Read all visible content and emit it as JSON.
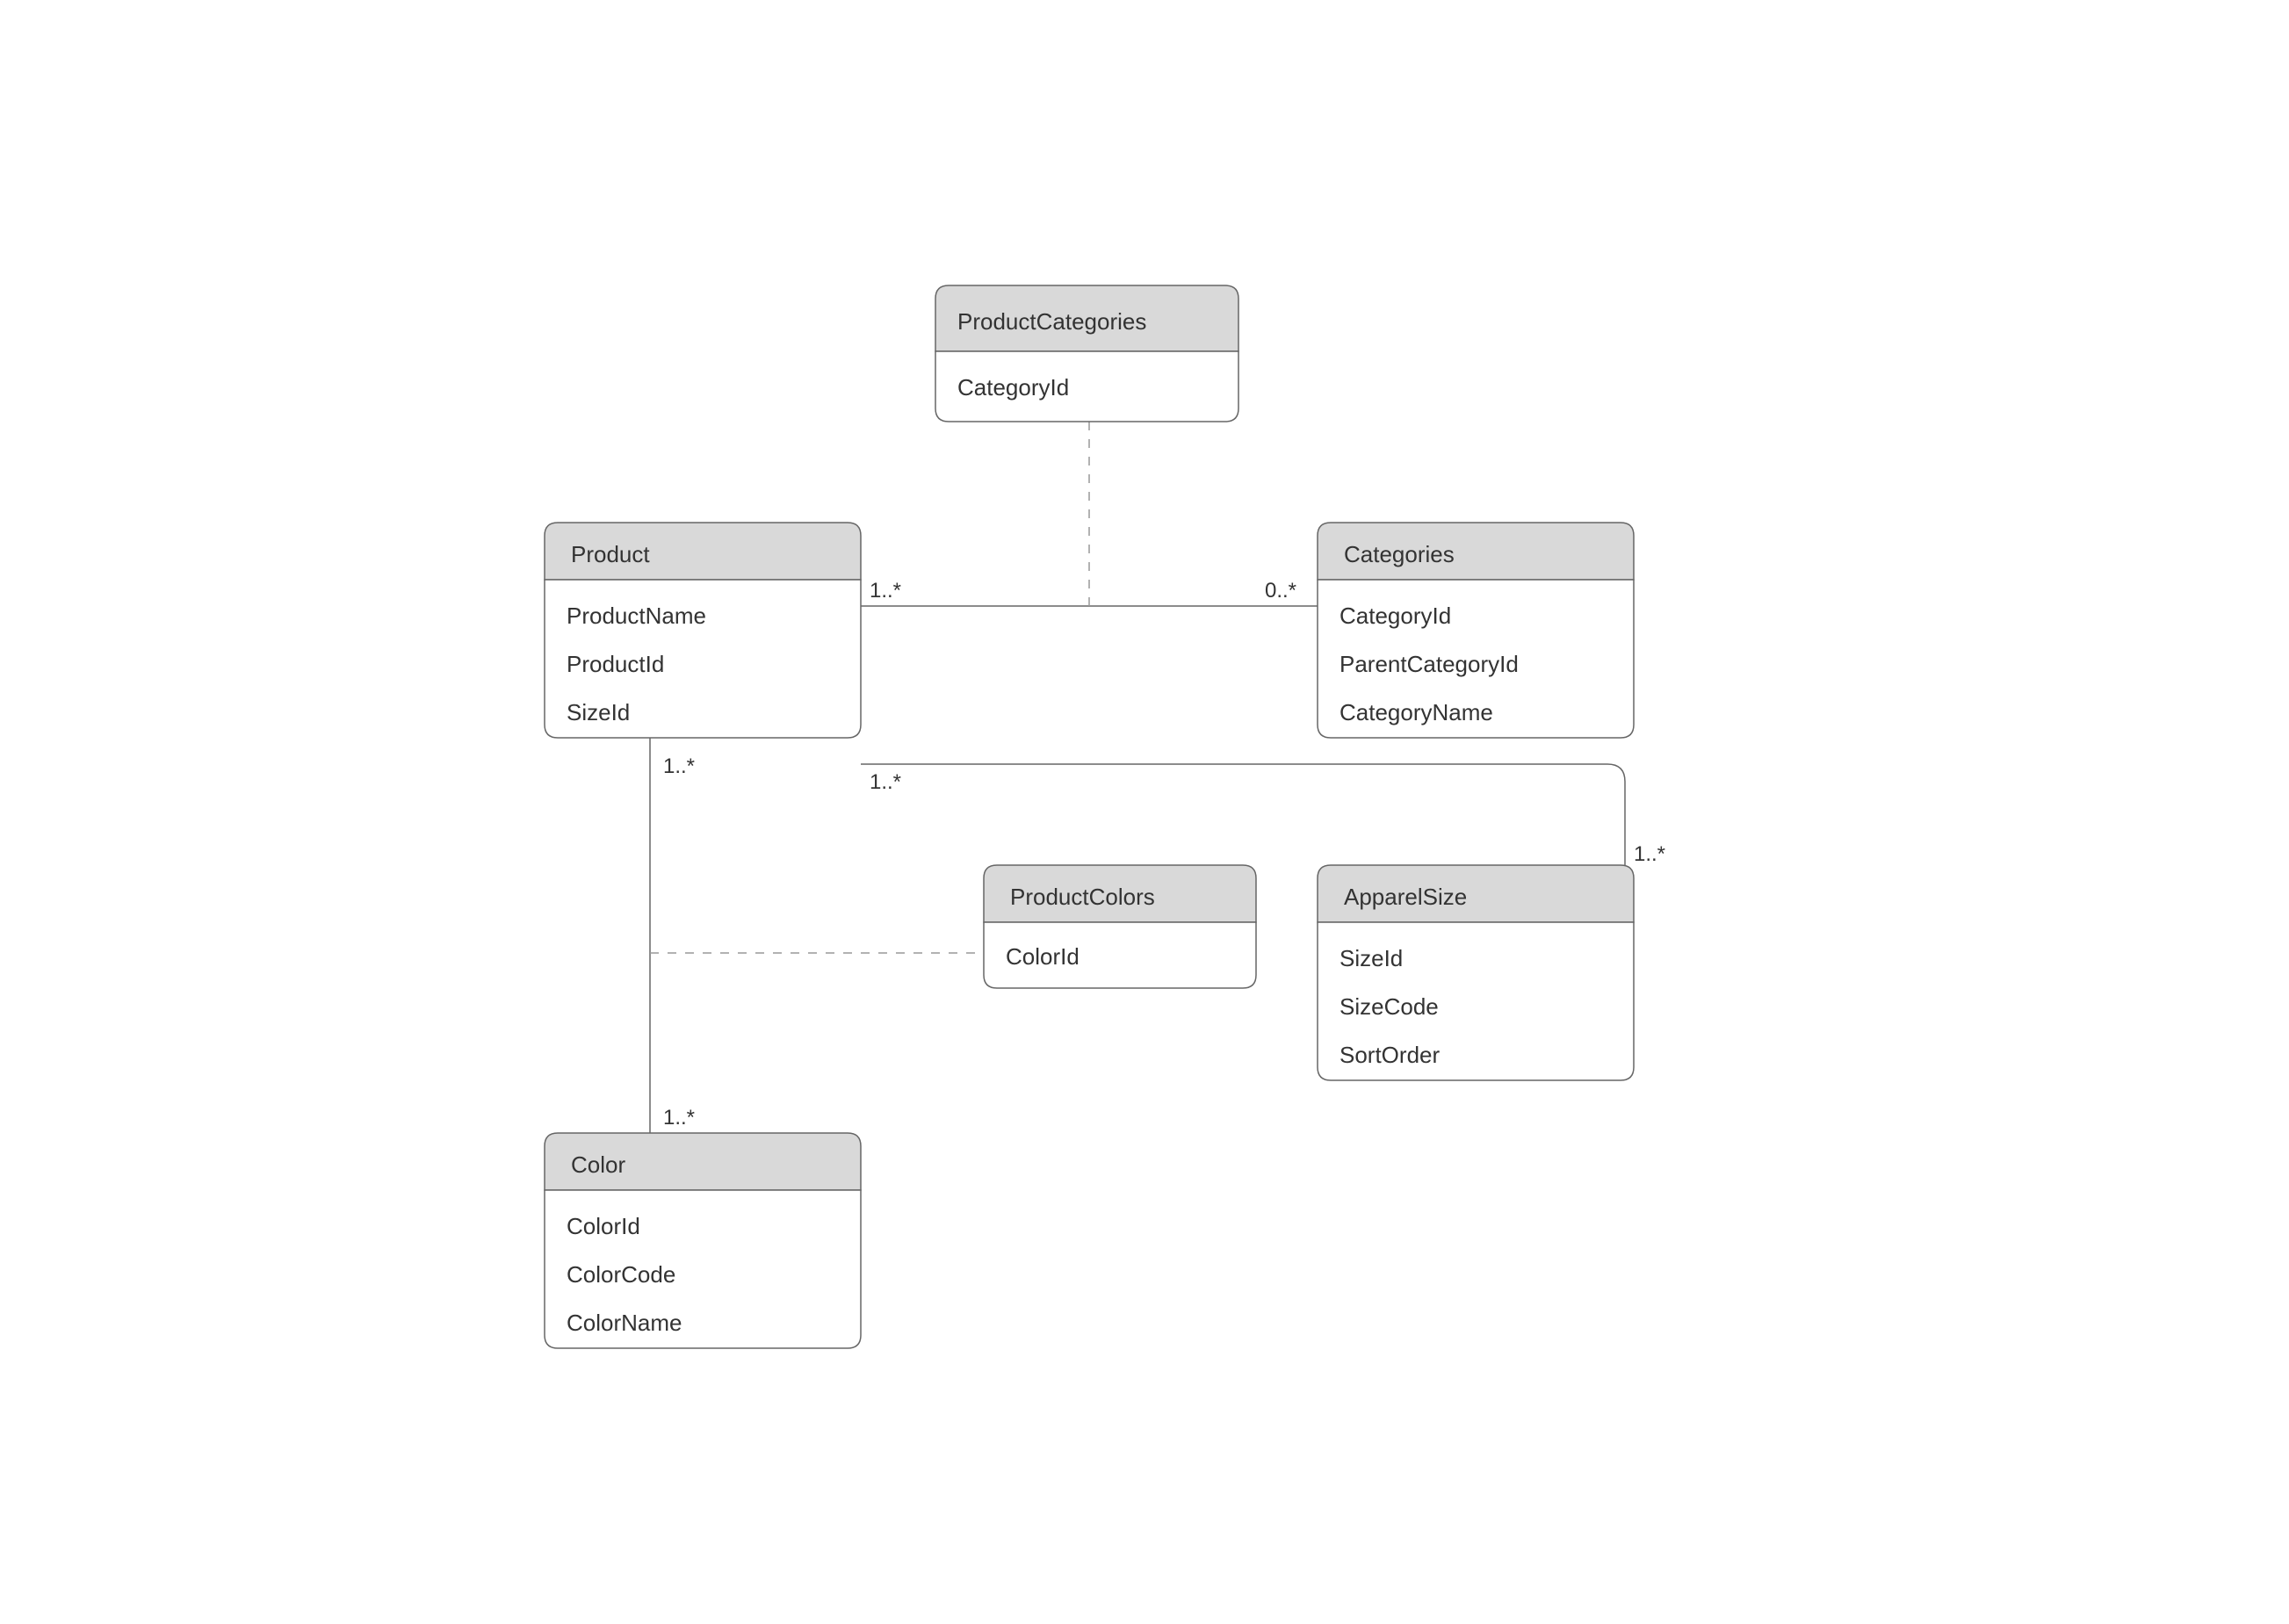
{
  "entities": {
    "productCategories": {
      "title": "ProductCategories",
      "attrs": [
        "CategoryId"
      ]
    },
    "product": {
      "title": "Product",
      "attrs": [
        "ProductName",
        "ProductId",
        "SizeId"
      ]
    },
    "categories": {
      "title": "Categories",
      "attrs": [
        "CategoryId",
        "ParentCategoryId",
        "CategoryName"
      ]
    },
    "productColors": {
      "title": "ProductColors",
      "attrs": [
        "ColorId"
      ]
    },
    "apparelSize": {
      "title": "ApparelSize",
      "attrs": [
        "SizeId",
        "SizeCode",
        "SortOrder"
      ]
    },
    "color": {
      "title": "Color",
      "attrs": [
        "ColorId",
        "ColorCode",
        "ColorName"
      ]
    }
  },
  "multiplicities": {
    "product_categories_left": "1..*",
    "product_categories_right": "0..*",
    "product_apparel_left": "1..*",
    "product_apparel_right": "1..*",
    "product_color_top": "1..*",
    "product_color_bottom": "1..*"
  }
}
